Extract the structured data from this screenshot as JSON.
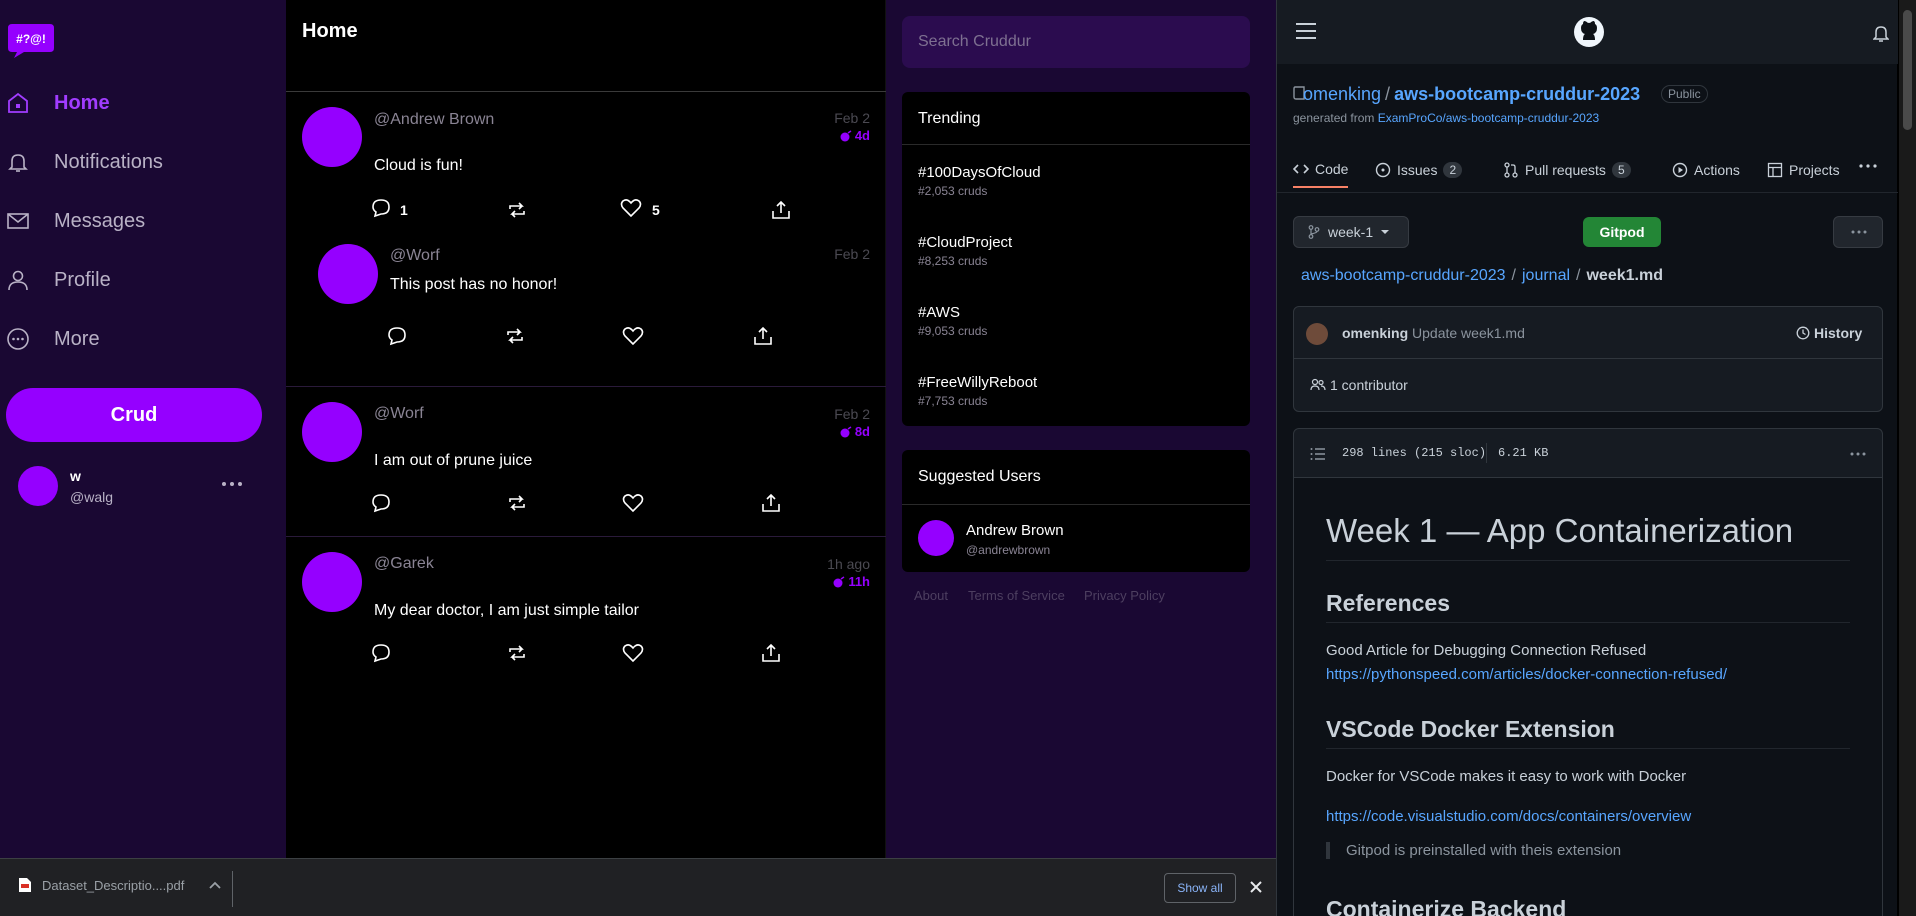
{
  "colors": {
    "accent": "#9500ff",
    "sidebar_bg": "#1a0833",
    "gh_link": "#58a6ff",
    "gitpod_green": "#238636"
  },
  "logo": {
    "text": "#?@!"
  },
  "nav": {
    "home": "Home",
    "notifications": "Notifications",
    "messages": "Messages",
    "profile": "Profile",
    "more": "More"
  },
  "crud_button": "Crud",
  "current_user": {
    "name": "w",
    "handle": "@walg"
  },
  "feed": {
    "title": "Home",
    "posts": [
      {
        "handle": "@Andrew Brown",
        "time": "Feb 2",
        "expires": "4d",
        "message": "Cloud is fun!",
        "replies": "1",
        "likes": "5",
        "reply": {
          "handle": "@Worf",
          "time": "Feb 2",
          "message": "This post has no honor!"
        }
      },
      {
        "handle": "@Worf",
        "time": "Feb 2",
        "expires": "8d",
        "message": "I am out of prune juice"
      },
      {
        "handle": "@Garek",
        "time": "1h ago",
        "expires": "11h",
        "message": "My dear doctor, I am just simple tailor"
      }
    ]
  },
  "search": {
    "placeholder": "Search Cruddur"
  },
  "trending": {
    "title": "Trending",
    "items": [
      {
        "tag": "#100DaysOfCloud",
        "count": "#2,053 cruds"
      },
      {
        "tag": "#CloudProject",
        "count": "#8,253 cruds"
      },
      {
        "tag": "#AWS",
        "count": "#9,053 cruds"
      },
      {
        "tag": "#FreeWillyReboot",
        "count": "#7,753 cruds"
      }
    ]
  },
  "suggested": {
    "title": "Suggested Users",
    "users": [
      {
        "name": "Andrew Brown",
        "handle": "@andrewbrown"
      }
    ]
  },
  "footer_links": {
    "about": "About",
    "terms": "Terms of Service",
    "privacy": "Privacy Policy"
  },
  "github": {
    "owner": "omenking",
    "repo": "aws-bootcamp-cruddur-2023",
    "visibility": "Public",
    "generated_prefix": "generated from",
    "generated_from": "ExamProCo/aws-bootcamp-cruddur-2023",
    "tabs": [
      {
        "label": "Code",
        "icon": "code-icon"
      },
      {
        "label": "Issues",
        "count": "2",
        "icon": "issue-icon"
      },
      {
        "label": "Pull requests",
        "count": "5",
        "icon": "pull-request-icon"
      },
      {
        "label": "Actions",
        "icon": "play-icon"
      },
      {
        "label": "Projects",
        "icon": "table-icon"
      }
    ],
    "branch": "week-1",
    "gitpod": "Gitpod",
    "breadcrumb": {
      "repo": "aws-bootcamp-cruddur-2023",
      "dir": "journal",
      "file": "week1.md"
    },
    "commit": {
      "author": "omenking",
      "message": "Update week1.md",
      "history": "History"
    },
    "contributors": "1 contributor",
    "file_info": {
      "lines": "298 lines (215 sloc)",
      "size": "6.21 KB"
    },
    "markdown": {
      "h1": "Week 1 — App Containerization",
      "h2_references": "References",
      "p_article": "Good Article for Debugging Connection Refused",
      "link_article": "https://pythonspeed.com/articles/docker-connection-refused/",
      "h2_vscode": "VSCode Docker Extension",
      "p_vscode": "Docker for VSCode makes it easy to work with Docker",
      "link_vscode": "https://code.visualstudio.com/docs/containers/overview",
      "quote": "Gitpod is preinstalled with theis extension",
      "h2_backend": "Containerize Backend"
    }
  },
  "downloads": {
    "file": "Dataset_Descriptio....pdf",
    "show_all": "Show all"
  }
}
